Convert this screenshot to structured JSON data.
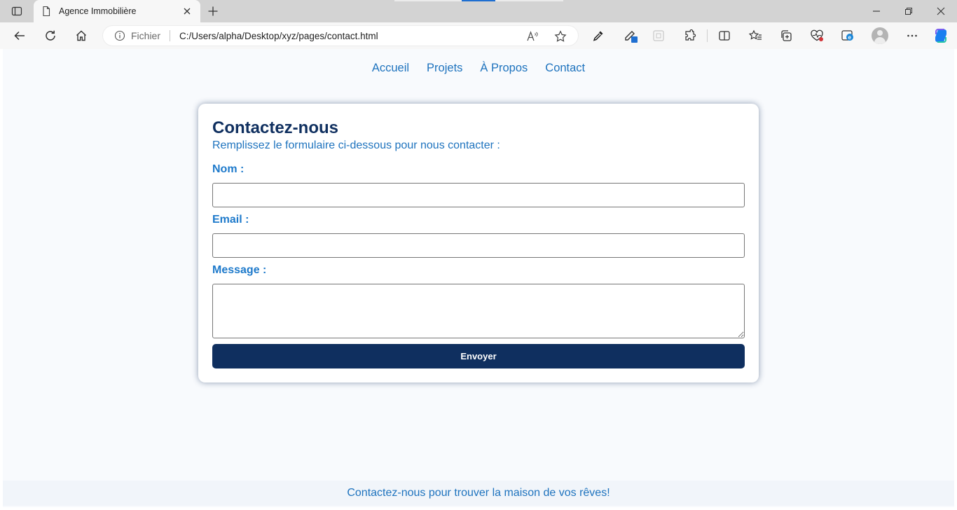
{
  "browser": {
    "tab_title": "Agence Immobilière",
    "address": {
      "scheme_label": "Fichier",
      "url": "C:/Users/alpha/Desktop/xyz/pages/contact.html"
    }
  },
  "page": {
    "nav": [
      {
        "label": "Accueil"
      },
      {
        "label": "Projets"
      },
      {
        "label": "À Propos"
      },
      {
        "label": "Contact"
      }
    ],
    "form": {
      "title": "Contactez-nous",
      "subtitle": "Remplissez le formulaire ci-dessous pour nous contacter :",
      "name_label": "Nom :",
      "name_value": "",
      "email_label": "Email :",
      "email_value": "",
      "message_label": "Message :",
      "message_value": "",
      "submit_label": "Envoyer"
    },
    "footer_text": "Contactez-nous pour trouver la maison de vos rêves!"
  },
  "colors": {
    "accent": "#1e73be",
    "heading": "#0f2f5f",
    "button": "#0f2f5f",
    "page_background": "#f8fafd",
    "edge_blue": "#1565c0"
  }
}
